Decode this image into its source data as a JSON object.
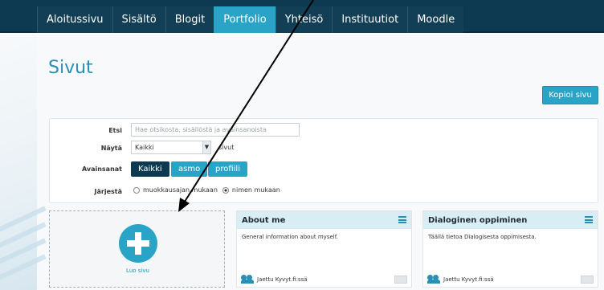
{
  "nav": {
    "items": [
      "Aloitussivu",
      "Sisältö",
      "Blogit",
      "Portfolio",
      "Yhteisö",
      "Instituutiot",
      "Moodle"
    ],
    "active": "Portfolio"
  },
  "page": {
    "title": "Sivut",
    "copy_button": "Kopioi sivu"
  },
  "filter": {
    "search_label": "Etsi",
    "search_placeholder": "Hae otsikosta, sisällöstä ja avainsanoista",
    "show_label": "Näytä",
    "show_value": "Kaikki",
    "show_suffix": "sivut",
    "tags_label": "Avainsanat",
    "tags": [
      "Kaikki",
      "asmo",
      "profiili"
    ],
    "sort_label": "Järjestä",
    "sort_options": [
      "muokkausajan mukaan",
      "nimen mukaan"
    ],
    "sort_selected": "nimen mukaan"
  },
  "cards": {
    "create_label": "Luo sivu",
    "items": [
      {
        "title": "About me",
        "description": "General information about myself.",
        "shared": "Jaettu Kyvyt.fi:ssä"
      },
      {
        "title": "Dialoginen oppiminen",
        "description": "Täällä tietoa Dialogisesta oppimisesta.",
        "shared": "Jaettu Kyvyt.fi:ssä"
      }
    ]
  },
  "colors": {
    "accent": "#2aa4c6",
    "navbar": "#0e3a51",
    "title": "#2a8fb6"
  }
}
